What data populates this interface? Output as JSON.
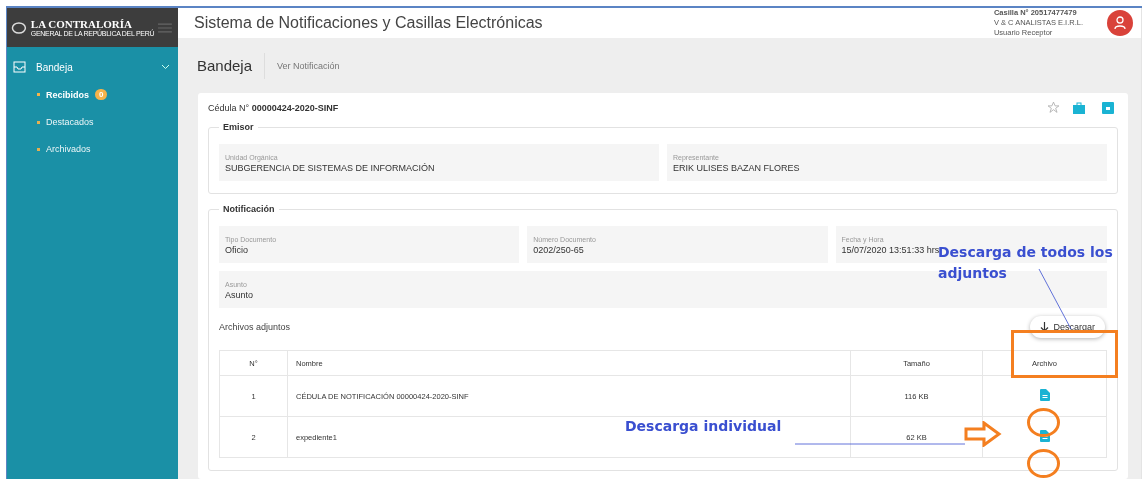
{
  "sidebar": {
    "logo_title": "LA CONTRALORÍA",
    "logo_subtitle": "GENERAL DE LA REPÚBLICA DEL PERÚ",
    "items": [
      {
        "label": "Bandeja",
        "expanded": true,
        "children": [
          {
            "label": "Recibidos",
            "badge": "0",
            "selected": true
          },
          {
            "label": "Destacados",
            "selected": false
          },
          {
            "label": "Archivados",
            "selected": false
          }
        ]
      }
    ]
  },
  "header": {
    "title": "Sistema de Notificaciones y Casillas Electrónicas",
    "casilla": "Casilla N° 20517477479",
    "company": "V & C ANALISTAS E.I.R.L.",
    "role": "Usuario Receptor"
  },
  "breadcrumb": {
    "title": "Bandeja",
    "current": "Ver Notificación"
  },
  "card": {
    "label": "Cédula N°",
    "number": "00000424-2020-SINF",
    "starred": false,
    "emisor": {
      "legend": "Emisor",
      "fields": [
        {
          "label": "Unidad Orgánica",
          "value": "SUBGERENCIA DE SISTEMAS DE INFORMACIÓN"
        },
        {
          "label": "Representante",
          "value": "ERIK ULISES BAZAN FLORES"
        }
      ]
    },
    "notificacion": {
      "legend": "Notificación",
      "fields": [
        {
          "label": "Tipo Documento",
          "value": "Oficio"
        },
        {
          "label": "Número Documento",
          "value": "0202/250-65"
        },
        {
          "label": "Fecha y Hora",
          "value": "15/07/2020 13:51:33 hrs"
        }
      ],
      "asunto": {
        "label": "Asunto",
        "value": "Asunto"
      }
    },
    "attachments": {
      "title": "Archivos adjuntos",
      "button": "Descargar",
      "columns": [
        "N°",
        "Nombre",
        "Tamaño",
        "Archivo"
      ],
      "rows": [
        {
          "n": "1",
          "name": "CÉDULA DE NOTIFICACIÓN 00000424-2020-SINF",
          "size": "116 KB"
        },
        {
          "n": "2",
          "name": "expediente1",
          "size": "62 KB"
        }
      ]
    }
  },
  "annotations": [
    {
      "text": "Descarga de todos los adjuntos"
    },
    {
      "text": "Descarga individual"
    }
  ]
}
